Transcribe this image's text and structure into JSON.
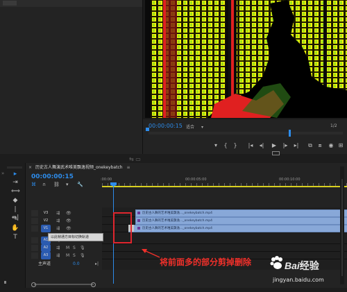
{
  "monitor": {
    "timecode": "00:00:00:15",
    "fit_label": "适合",
    "ratio": "1/2",
    "tab_badge": "1"
  },
  "transport": {
    "buttons": [
      "marker-icon",
      "in-point-icon",
      "out-point-icon",
      "go-in-icon",
      "step-back-icon",
      "play-icon",
      "step-forward-icon",
      "go-out-icon",
      "insert-icon",
      "overwrite-icon",
      "export-frame-icon",
      "settings-icon"
    ]
  },
  "sequence": {
    "tab_title": "历史古人舞演武术唯美飘逸视频_onekeybatch",
    "timecode": "00:00:00:15",
    "ruler_labels": [
      ":00:00",
      "00:00:05:00",
      "00:00:10:00"
    ]
  },
  "tracks": [
    {
      "id": "V3",
      "label": "V3",
      "type": "video"
    },
    {
      "id": "V2",
      "label": "V2",
      "type": "video"
    },
    {
      "id": "V1",
      "label": "V1",
      "type": "video",
      "highlight": true
    },
    {
      "id": "A1",
      "label": "A1",
      "type": "audio",
      "highlight": true
    },
    {
      "id": "A2",
      "label": "A2",
      "type": "audio",
      "highlight": true
    },
    {
      "id": "A3",
      "label": "A3",
      "type": "audio",
      "highlight": true
    }
  ],
  "audio_track_icons": {
    "m": "M",
    "s": "S"
  },
  "master": {
    "label": "主声道",
    "value": "0.0"
  },
  "clips": [
    {
      "track": "V3",
      "label": "历史古人舞的艺术唯美飘逸..._onekeybatch.mp4"
    },
    {
      "track": "V2",
      "label": "历史古人舞的艺术唯美飘逸..._onekeybatch.mp4"
    },
    {
      "track": "V1",
      "label": "历史古人舞的艺术唯美飘逸..._onekeybatch.mp4"
    }
  ],
  "tooltip": "以此帧通方目标切换轨道",
  "annotation": "将前面多的部分剪掉删除",
  "watermark": {
    "brand": "Bai",
    "cn": "经验",
    "url": "jingyan.baidu.com"
  },
  "colors": {
    "accent": "#2d8ceb",
    "annotation": "#f0302a",
    "clip": "#88a8d8",
    "work_area": "#d8d020"
  }
}
